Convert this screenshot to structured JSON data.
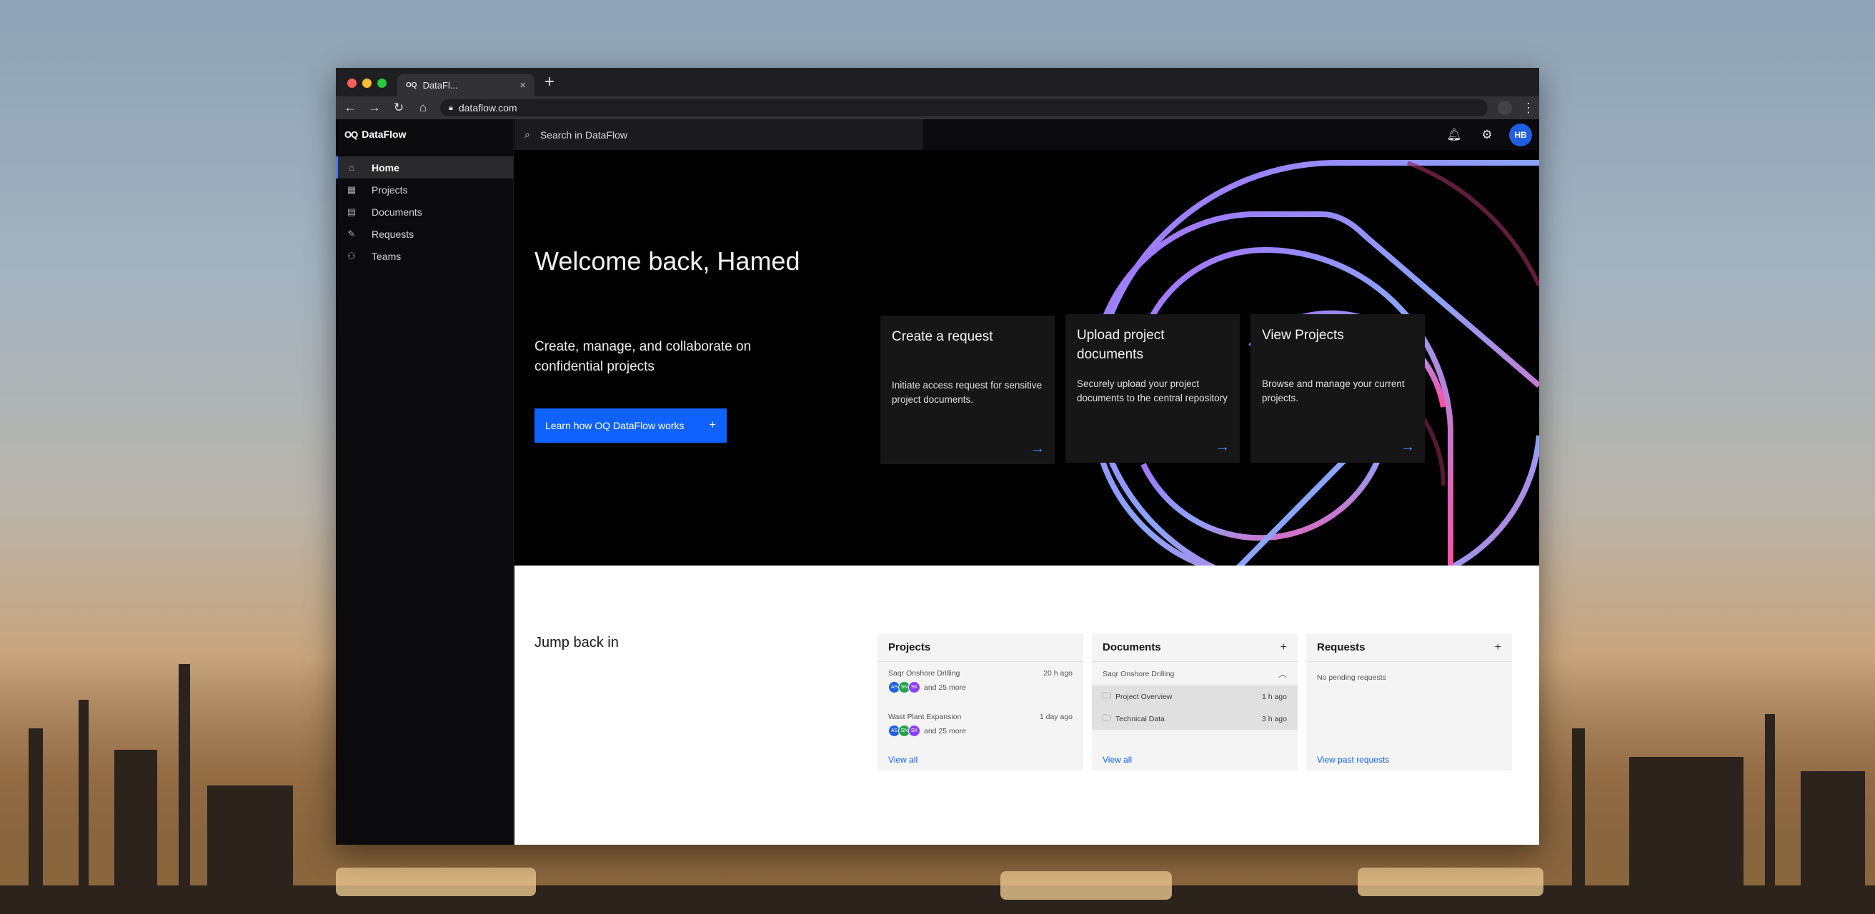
{
  "browser": {
    "tab_title": "DataFl...",
    "tab_icon": "oq-logo",
    "url": "dataflow.com"
  },
  "app": {
    "brand": "DataFlow",
    "logo": "OQ",
    "search_placeholder": "Search in DataFlow",
    "avatar_initials": "HB",
    "accent": "#0f62fe"
  },
  "sidebar": {
    "items": [
      {
        "label": "Home",
        "icon": "home-icon",
        "active": true
      },
      {
        "label": "Projects",
        "icon": "projects-icon"
      },
      {
        "label": "Documents",
        "icon": "document-icon"
      },
      {
        "label": "Requests",
        "icon": "edit-icon"
      },
      {
        "label": "Teams",
        "icon": "people-icon"
      }
    ]
  },
  "hero": {
    "welcome": "Welcome back, Hamed",
    "subtitle": "Create, manage, and collaborate on confidential projects",
    "cta_label": "Learn how OQ DataFlow works",
    "cards": [
      {
        "title": "Create a request",
        "body": "Initiate access request for sensitive project documents."
      },
      {
        "title": "Upload project documents",
        "body": "Securely upload your project documents to the central repository"
      },
      {
        "title": "View Projects",
        "body": "Browse and manage your current projects."
      }
    ]
  },
  "jump": {
    "title": "Jump back in",
    "projects": {
      "title": "Projects",
      "rows": [
        {
          "name": "Saqr Onshore Drilling",
          "time": "20 h ago",
          "more": "and 25 more",
          "avatars": [
            "AS",
            "SN",
            "SK"
          ]
        },
        {
          "name": "Wast Plant Expansion",
          "time": "1 day ago",
          "more": "and 25 more",
          "avatars": [
            "AS",
            "SN",
            "SK"
          ]
        }
      ],
      "view_all": "View all"
    },
    "documents": {
      "title": "Documents",
      "group": "Saqr Onshore Drilling",
      "items": [
        {
          "name": "Project Overview",
          "time": "1 h ago"
        },
        {
          "name": "Technical Data",
          "time": "3 h ago"
        }
      ],
      "view_all": "View all"
    },
    "requests": {
      "title": "Requests",
      "empty": "No pending requests",
      "link": "View past requests"
    }
  }
}
